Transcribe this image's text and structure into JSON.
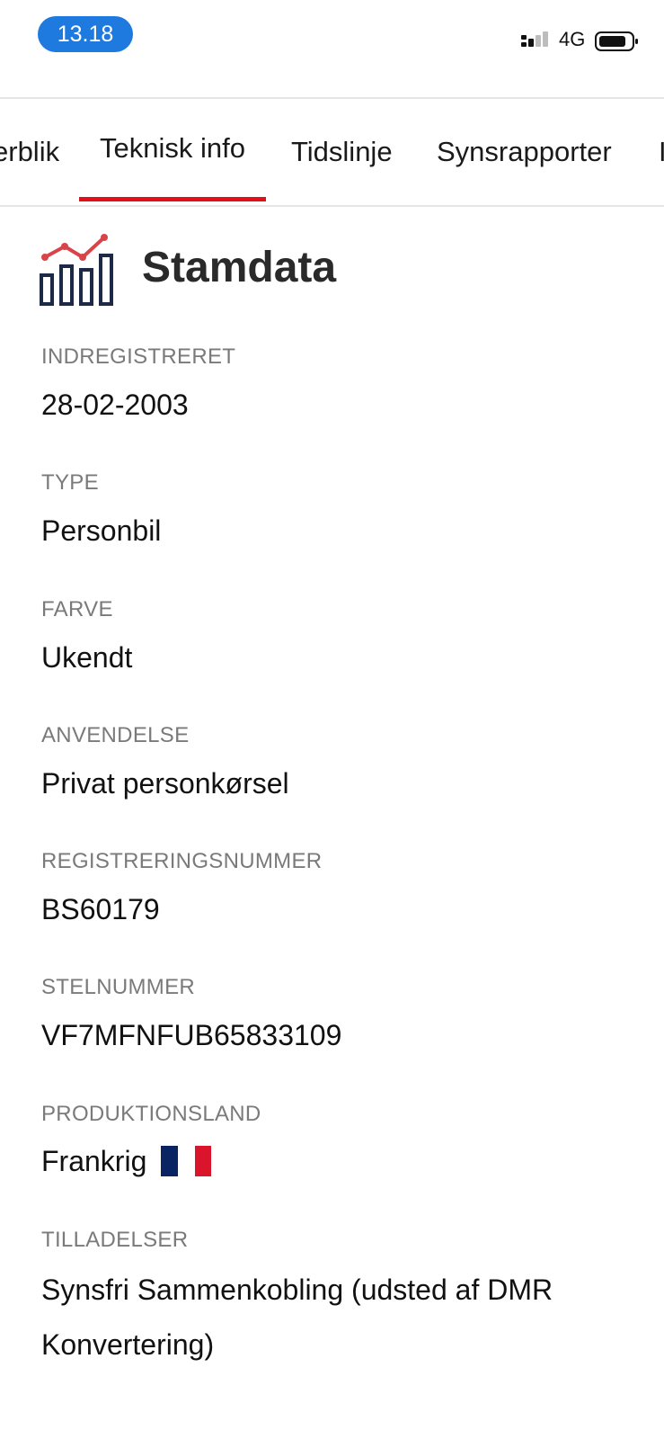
{
  "status_bar": {
    "time": "13.18",
    "network": "4G",
    "icons": [
      "signal-icon",
      "battery-icon"
    ]
  },
  "tabs": [
    {
      "label": "Overblik",
      "visible_text": "erblik",
      "active": false
    },
    {
      "label": "Teknisk info",
      "active": true
    },
    {
      "label": "Tidslinje",
      "active": false
    },
    {
      "label": "Synsrapporter",
      "active": false
    },
    {
      "label": "I",
      "active": false
    }
  ],
  "section": {
    "title": "Stamdata",
    "icon": "chart-icon"
  },
  "fields": [
    {
      "label": "INDREGISTRERET",
      "value": "28-02-2003"
    },
    {
      "label": "TYPE",
      "value": "Personbil"
    },
    {
      "label": "FARVE",
      "value": "Ukendt"
    },
    {
      "label": "ANVENDELSE",
      "value": "Privat personkørsel"
    },
    {
      "label": "REGISTRERINGSNUMMER",
      "value": "BS60179"
    },
    {
      "label": "STELNUMMER",
      "value": "VF7MFNFUB65833109"
    },
    {
      "label": "PRODUKTIONSLAND",
      "value": "Frankrig",
      "flag": "france-flag-icon"
    },
    {
      "label": "TILLADELSER",
      "value": "Synsfri Sammenkobling (udsted af DMR Konvertering)"
    }
  ],
  "colors": {
    "accent": "#e3101a",
    "time_pill": "#1f7ae0",
    "icon_navy": "#1c2a45",
    "icon_red": "#d9434a",
    "label_gray": "#7a7a7a"
  }
}
